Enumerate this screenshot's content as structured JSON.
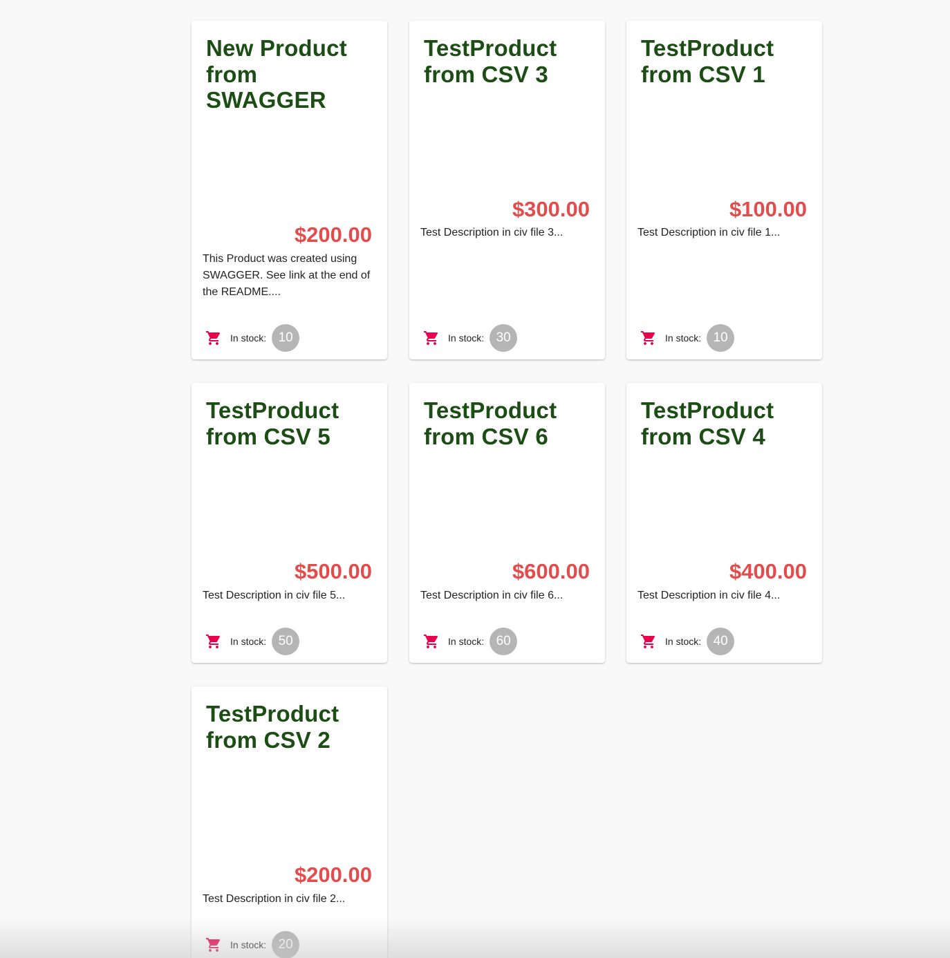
{
  "theme": {
    "title_color": "#1b4d14",
    "price_color": "#e24c4c",
    "cart_icon_color": "#e8004c",
    "badge_color": "#b5b5b5",
    "background": "#f9f9f9"
  },
  "stock_label": "In stock:",
  "cart_icon": "shopping-cart-icon",
  "products": [
    {
      "title": "New Product from SWAGGER",
      "price": "$200.00",
      "description": "This Product was created using SWAGGER. See link at the end of the README....",
      "stock": "10"
    },
    {
      "title": "TestProduct from CSV 3",
      "price": "$300.00",
      "description": "Test Description in civ file 3...",
      "stock": "30"
    },
    {
      "title": "TestProduct from CSV 1",
      "price": "$100.00",
      "description": "Test Description in civ file 1...",
      "stock": "10"
    },
    {
      "title": "TestProduct from CSV 5",
      "price": "$500.00",
      "description": "Test Description in civ file 5...",
      "stock": "50"
    },
    {
      "title": "TestProduct from CSV 6",
      "price": "$600.00",
      "description": "Test Description in civ file 6...",
      "stock": "60"
    },
    {
      "title": "TestProduct from CSV 4",
      "price": "$400.00",
      "description": "Test Description in civ file 4...",
      "stock": "40"
    },
    {
      "title": "TestProduct from CSV 2",
      "price": "$200.00",
      "description": "Test Description in civ file 2...",
      "stock": "20"
    }
  ]
}
